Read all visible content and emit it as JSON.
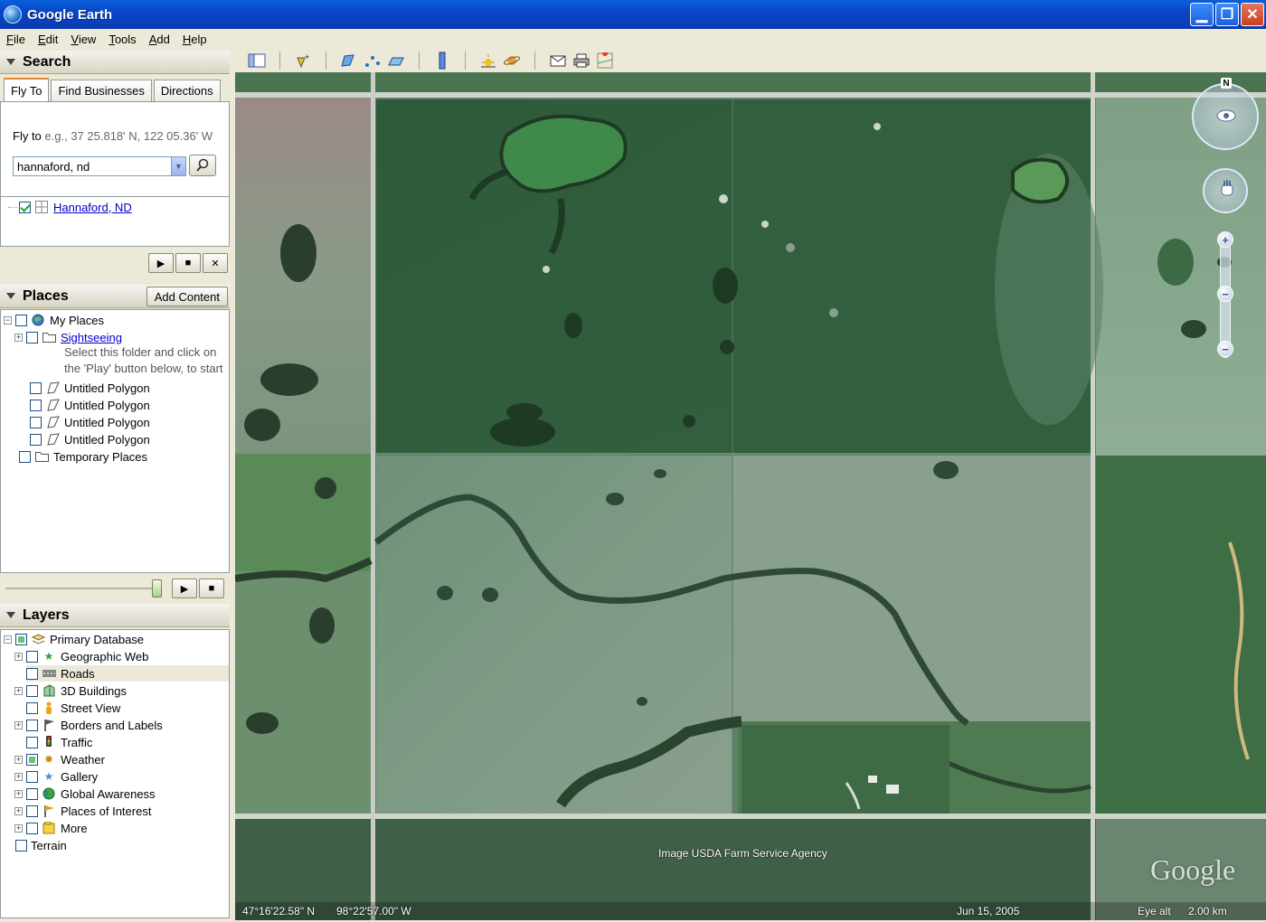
{
  "window": {
    "title": "Google Earth"
  },
  "menu": [
    "File",
    "Edit",
    "View",
    "Tools",
    "Add",
    "Help"
  ],
  "search": {
    "header": "Search",
    "tabs": [
      "Fly To",
      "Find Businesses",
      "Directions"
    ],
    "fly_to_label": "Fly to",
    "fly_to_hint": "e.g., 37 25.818' N, 122 05.36' W",
    "query_value": "hannaford, nd",
    "result": "Hannaford, ND"
  },
  "places": {
    "header": "Places",
    "add_content_label": "Add Content",
    "items": [
      {
        "label": "My Places"
      },
      {
        "label": "Sightseeing"
      },
      {
        "label": "Untitled Polygon"
      },
      {
        "label": "Untitled Polygon"
      },
      {
        "label": "Untitled Polygon"
      },
      {
        "label": "Untitled Polygon"
      },
      {
        "label": "Temporary Places"
      }
    ],
    "sightseeing_desc_1": "Select this folder and click on",
    "sightseeing_desc_2": "the 'Play' button below, to start"
  },
  "layers": {
    "header": "Layers",
    "items": [
      {
        "label": "Primary Database"
      },
      {
        "label": "Geographic Web"
      },
      {
        "label": "Roads"
      },
      {
        "label": "3D Buildings"
      },
      {
        "label": "Street View"
      },
      {
        "label": "Borders and Labels"
      },
      {
        "label": "Traffic"
      },
      {
        "label": "Weather"
      },
      {
        "label": "Gallery"
      },
      {
        "label": "Global Awareness"
      },
      {
        "label": "Places of Interest"
      },
      {
        "label": "More"
      },
      {
        "label": "Terrain"
      }
    ]
  },
  "map": {
    "attribution": "Image USDA Farm Service Agency",
    "logo": "Google",
    "latitude": "47°16'22.58\" N",
    "longitude": "98°22'57.00\" W",
    "imagery_date": "Jun 15, 2005",
    "eye_alt_label": "Eye alt",
    "eye_alt_value": "2.00 km",
    "compass_north": "N"
  },
  "colors": {
    "titlebar": "#0a4fc8",
    "dark_field": "#2f5a3a",
    "light_field": "#7a9a84",
    "road": "#d8dcd4"
  }
}
